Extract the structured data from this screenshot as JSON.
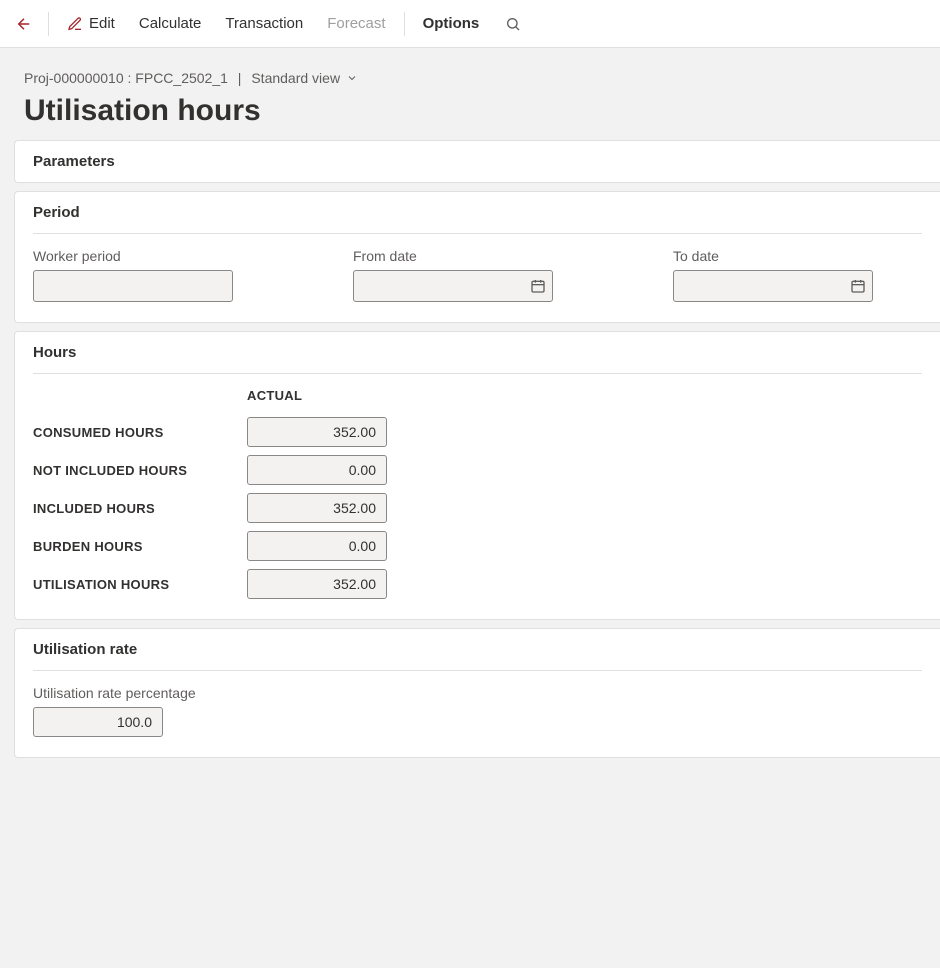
{
  "toolbar": {
    "edit": "Edit",
    "calculate": "Calculate",
    "transaction": "Transaction",
    "forecast": "Forecast",
    "options": "Options"
  },
  "breadcrumb": {
    "project": "Proj-000000010 : FPCC_2502_1",
    "view": "Standard view"
  },
  "page_title": "Utilisation hours",
  "panels": {
    "parameters": "Parameters",
    "period": {
      "title": "Period",
      "worker_period_label": "Worker period",
      "worker_period_value": "",
      "from_date_label": "From date",
      "from_date_value": "",
      "to_date_label": "To date",
      "to_date_value": ""
    },
    "hours": {
      "title": "Hours",
      "column_header": "ACTUAL",
      "rows": {
        "consumed_label": "CONSUMED HOURS",
        "consumed_value": "352.00",
        "not_included_label": "NOT INCLUDED HOURS",
        "not_included_value": "0.00",
        "included_label": "INCLUDED HOURS",
        "included_value": "352.00",
        "burden_label": "BURDEN HOURS",
        "burden_value": "0.00",
        "utilisation_label": "UTILISATION HOURS",
        "utilisation_value": "352.00"
      }
    },
    "rate": {
      "title": "Utilisation rate",
      "percentage_label": "Utilisation rate percentage",
      "percentage_value": "100.0"
    }
  }
}
